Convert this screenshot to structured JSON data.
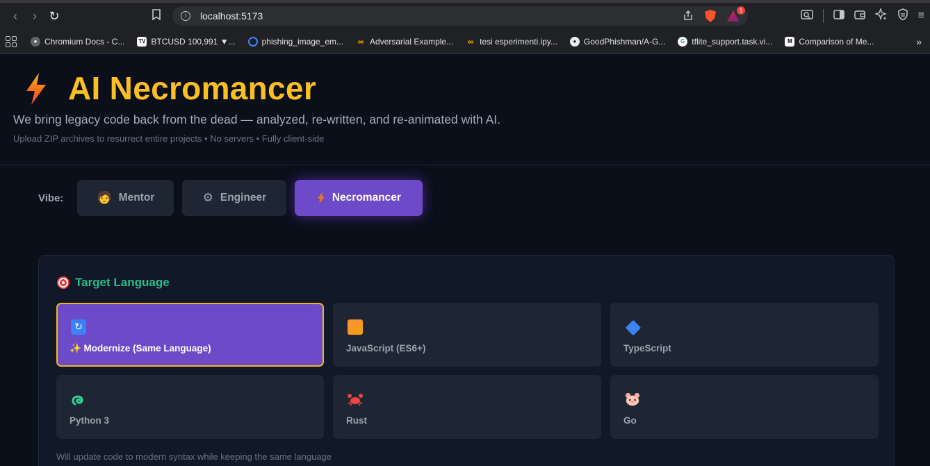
{
  "browser": {
    "url": "localhost:5173",
    "bat_badge": "1",
    "bookmarks": [
      {
        "label": "Chromium Docs - C...",
        "icon": "globe-icon",
        "color": "#5f6368"
      },
      {
        "label": "BTCUSD 100,991 ▼...",
        "icon": "tradingview-icon",
        "color": "#111111"
      },
      {
        "label": "phishing_image_em...",
        "icon": "colab-icon",
        "color": "#4285f4"
      },
      {
        "label": "Adversarial Example...",
        "icon": "colab-icon",
        "color": "#f9ab00"
      },
      {
        "label": "tesi esperimenti.ipy...",
        "icon": "colab-icon",
        "color": "#f9ab00"
      },
      {
        "label": "GoodPhishman/A-G...",
        "icon": "github-icon",
        "color": "#e8eaed"
      },
      {
        "label": "tflite_support.task.vi...",
        "icon": "google-icon",
        "color": "#ffffff"
      },
      {
        "label": "Comparison of Me...",
        "icon": "medium-icon",
        "color": "#000000"
      }
    ]
  },
  "header": {
    "title": "AI Necromancer",
    "tagline": "We bring legacy code back from the dead — analyzed, re-written, and re-animated with AI.",
    "subline": "Upload ZIP archives to resurrect entire projects • No servers • Fully client-side"
  },
  "vibe": {
    "label": "Vibe:",
    "options": [
      {
        "label": "Mentor",
        "icon": "🧑‍🏫",
        "active": false
      },
      {
        "label": "Engineer",
        "icon": "⚙️",
        "active": false
      },
      {
        "label": "Necromancer",
        "icon": "⚡",
        "active": true
      }
    ]
  },
  "target": {
    "title": "Target Language",
    "options": [
      {
        "label": "✨ Modernize (Same Language)",
        "icon": "🔄",
        "selected": true
      },
      {
        "label": "JavaScript (ES6+)",
        "icon": "",
        "selected": false
      },
      {
        "label": "TypeScript",
        "icon": "",
        "selected": false
      },
      {
        "label": "Python 3",
        "icon": "🐍",
        "selected": false
      },
      {
        "label": "Rust",
        "icon": "🦀",
        "selected": false
      },
      {
        "label": "Go",
        "icon": "🐹",
        "selected": false
      }
    ],
    "hint": "Will update code to modern syntax while keeping the same language"
  },
  "colors": {
    "accent": "#fbbf24",
    "active_purple": "#6d4ac8",
    "section_green": "#22c08a"
  }
}
